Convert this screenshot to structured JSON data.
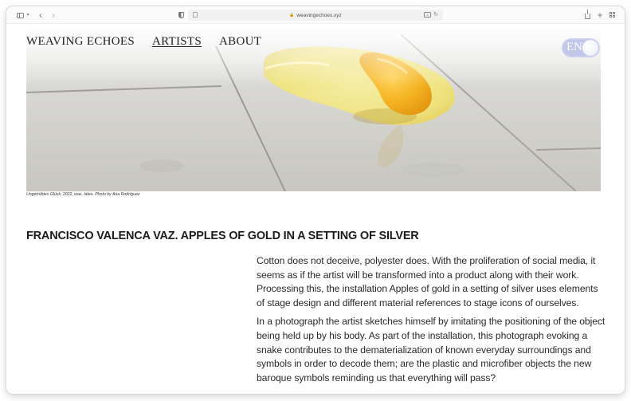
{
  "browser": {
    "url": "weavingechoes.xyz",
    "icons": {
      "sidebar": "sidebar-icon",
      "tab_overview": "chevron-down-icon",
      "back": "chevron-left-icon",
      "forward": "chevron-right-icon",
      "privacy": "shield-icon",
      "page": "page-icon",
      "lock": "lock-icon",
      "translate": "translate-icon",
      "reload": "reload-icon",
      "share": "share-icon",
      "new_tab": "plus-icon",
      "tabs": "tabs-grid-icon"
    }
  },
  "site": {
    "nav": {
      "brand": "WEAVING ECHOES",
      "artists": "ARTISTS",
      "about": "ABOUT",
      "active": "artists"
    },
    "language_toggle": {
      "label": "EN"
    }
  },
  "hero": {
    "caption": "Ungetrübtes Glück, 2022, wax, latex. Photo by Ana Rodríguez"
  },
  "article": {
    "title": "FRANCISCO VALENCA VAZ. APPLES OF GOLD IN A SETTING OF SILVER",
    "paragraphs": [
      "Cotton does not deceive, polyester does. With the proliferation of social media, it seems as if the artist will be transformed into a product along with their work. Processing this, the installation Apples of gold in a setting of silver uses elements of stage design and different material references to stage icons of ourselves.",
      "In a photograph the artist sketches himself by imitating the positioning of the object being held up by his body. As part of the installation, this photograph evoking a snake contributes to the dematerialization of known everyday surroundings and symbols in order to decode them; are the plastic and microfiber objects the new baroque symbols reminding us that everything will pass?"
    ]
  },
  "colors": {
    "toggle": "#bec4e8",
    "text": "#1a1a1a",
    "yolk": "#f4b321",
    "wax_puddle": "#f1e69a"
  }
}
